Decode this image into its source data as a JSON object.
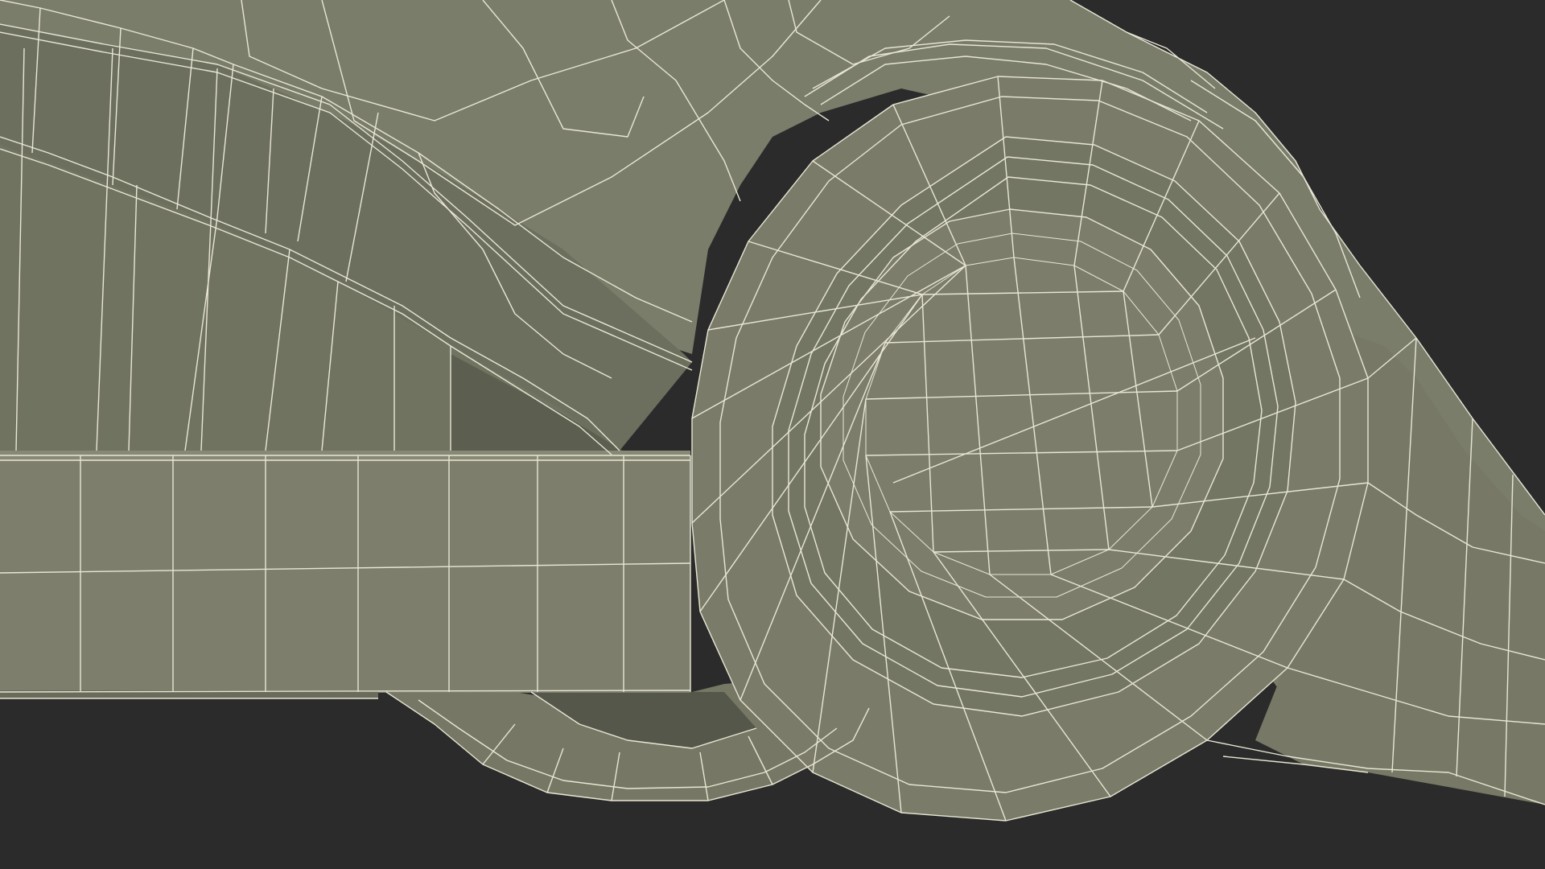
{
  "scene": {
    "background_color": "#2b2b2b",
    "mesh_color": "#7a7c6a",
    "mesh_shadow_color": "#5f6152",
    "mesh_highlight_color": "#878a76",
    "wire_color": "#e9e6d4",
    "render_style": "wireframe-over-shaded",
    "subject": "mesh-model-closeup"
  }
}
